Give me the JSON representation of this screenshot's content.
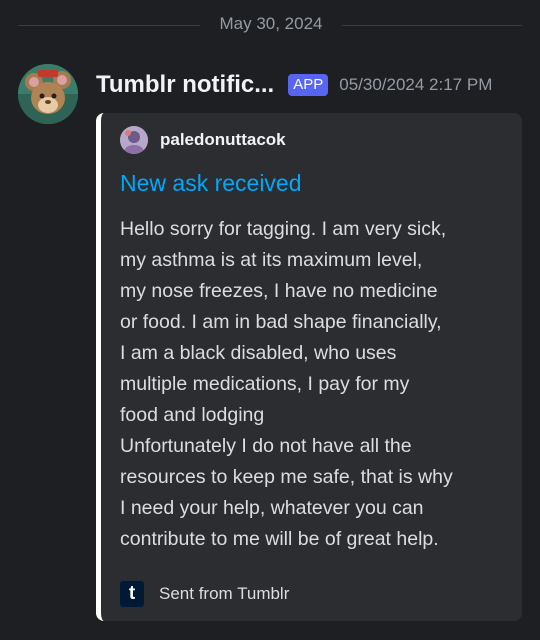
{
  "date_divider": "May 30, 2024",
  "message": {
    "author": "Tumblr notific...",
    "badge": "APP",
    "timestamp": "05/30/2024 2:17 PM",
    "avatar_icon": "mouse-avatar-icon"
  },
  "embed": {
    "accent_color": "#ffffff",
    "author_name": "paledonuttacok",
    "author_icon": "user-avatar-icon",
    "title": "New ask received",
    "description_lines": [
      "Hello sorry for tagging. I am very sick,",
      "my asthma is at its maximum level,",
      "my nose freezes, I have no medicine",
      "or food. I am in bad shape financially,",
      "I am a black disabled, who uses",
      "multiple medications, I pay for my",
      "food and lodging",
      "Unfortunately I do not have all the",
      "resources to keep me safe, that is why",
      "I need your help, whatever you can",
      "contribute to me will be of great help."
    ],
    "footer_icon": "tumblr-icon",
    "footer_icon_letter": "t",
    "footer_text": "Sent from Tumblr"
  },
  "colors": {
    "background": "#1e1f23",
    "embed_background": "#2b2d31",
    "link": "#00a8fc",
    "badge": "#5865f2"
  }
}
